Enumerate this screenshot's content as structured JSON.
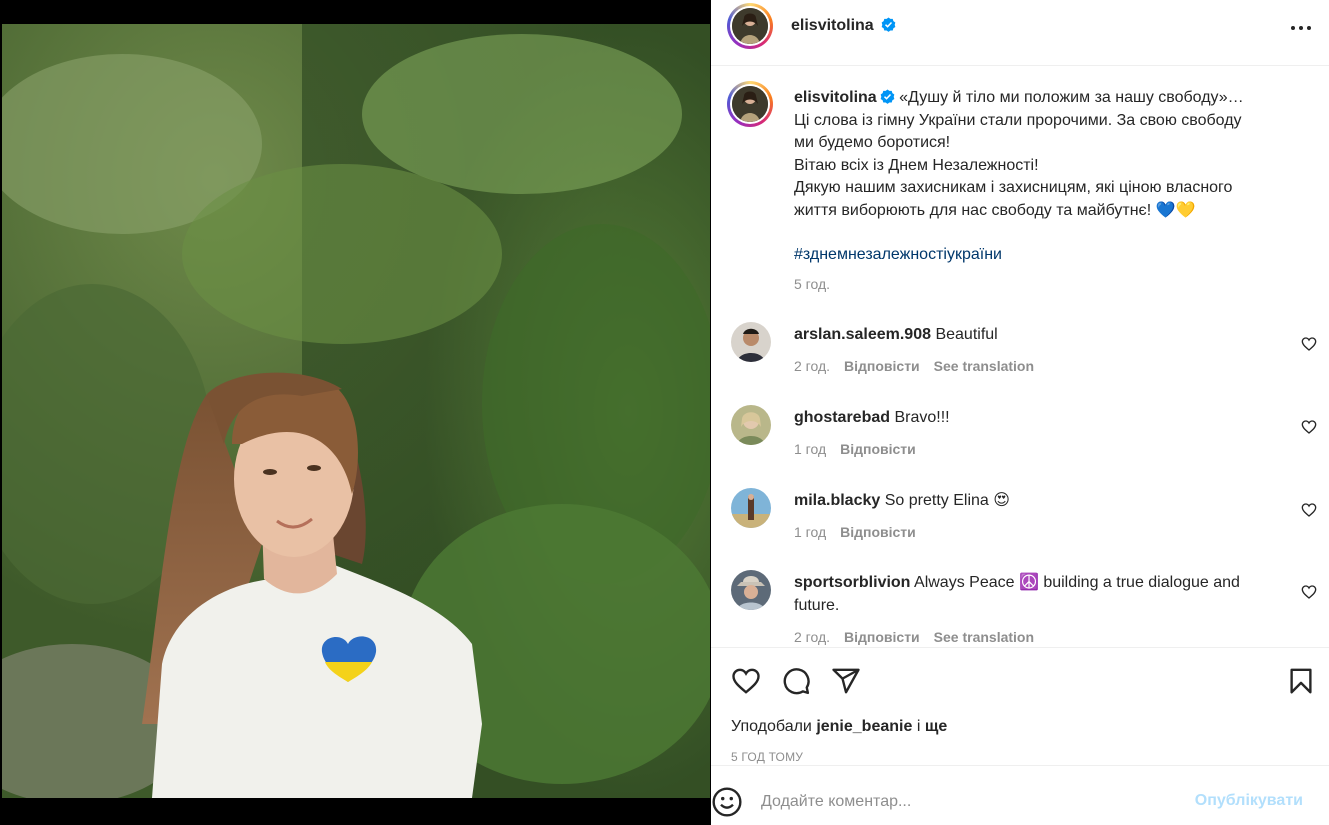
{
  "post": {
    "author": "elisvitolina",
    "caption": {
      "first_line": "«Душу й тіло ми положим за нашу свободу»…",
      "lines": [
        "Ці слова із гімну України стали пророчими. За свою свободу",
        "ми будемо боротися!",
        "Вітаю всіх із Днем Незалежності!",
        "Дякую нашим захисникам і захисницям, які ціною власного",
        "життя виборюють для нас свободу та майбутнє! 💙💛"
      ],
      "hashtag": "#зднемнезалежностіукраїни",
      "time": "5 год."
    },
    "comments": [
      {
        "user": "arslan.saleem.908",
        "text": "Beautiful",
        "time": "2 год.",
        "reply": "Відповісти",
        "translate": "See translation"
      },
      {
        "user": "ghostarebad",
        "text": "Bravo!!!",
        "time": "1 год",
        "reply": "Відповісти",
        "translate": ""
      },
      {
        "user": "mila.blacky",
        "text": "So pretty Elina 😍",
        "time": "1 год",
        "reply": "Відповісти",
        "translate": ""
      },
      {
        "user": "sportsorblivion",
        "text": "Always Peace ☮️ building a true dialogue and future.",
        "time": "2 год.",
        "reply": "Відповісти",
        "translate": "See translation"
      }
    ],
    "likes": {
      "prefix": "Уподобали",
      "user": "jenie_beanie",
      "connector": "і",
      "rest": "ще"
    },
    "posted_ago": "5 ГОД ТОМУ",
    "composer": {
      "placeholder": "Додайте коментар...",
      "post_label": "Опублікувати"
    }
  },
  "colors": {
    "verified": "#0095f6",
    "link": "#00376b",
    "muted": "#8e8e8e",
    "post_disabled": "#b2dffc"
  },
  "icons": [
    "more-icon",
    "verified-icon",
    "heart-icon",
    "comment-icon",
    "share-icon",
    "bookmark-icon",
    "emoji-icon"
  ]
}
